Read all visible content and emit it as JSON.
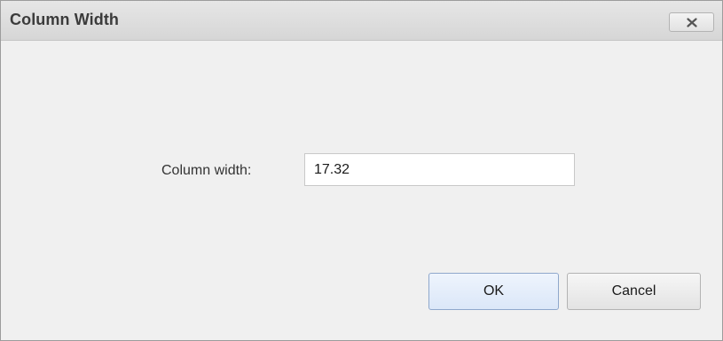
{
  "dialog": {
    "title": "Column Width",
    "close_icon": "close-icon",
    "field": {
      "label": "Column width:",
      "value": "17.32"
    },
    "buttons": {
      "ok_label": "OK",
      "cancel_label": "Cancel"
    }
  },
  "colors": {
    "title_bar": "#dcdcdc",
    "body": "#f0f0f0",
    "ok_border": "#8fa8cc",
    "ok_fill": "#dbe7f8"
  }
}
